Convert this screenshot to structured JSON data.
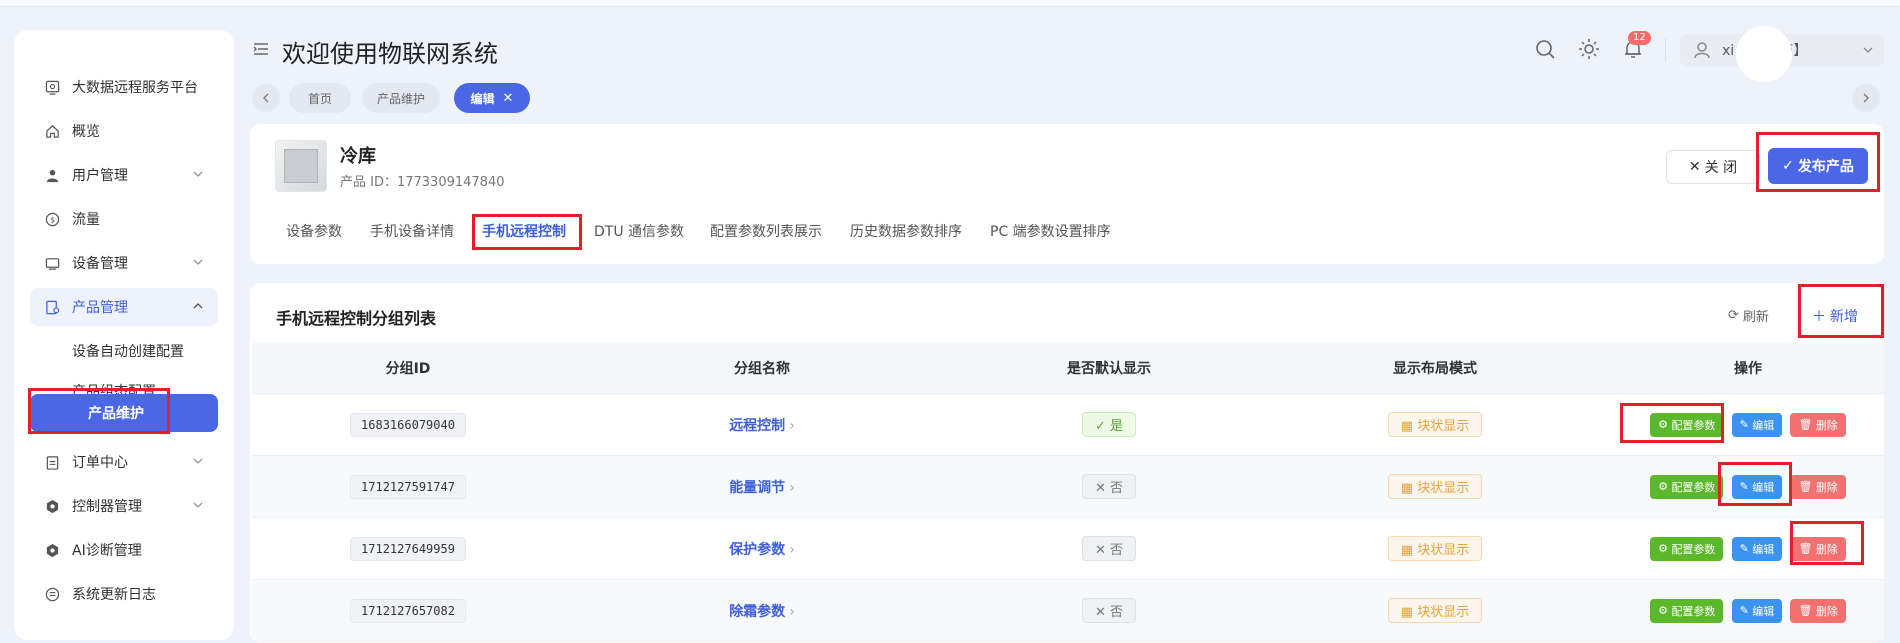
{
  "app": {
    "title": "欢迎使用物联网系统",
    "user_name": "xi st【厂商】",
    "notification_count": "12"
  },
  "sidebar": {
    "items": [
      {
        "label": "大数据远程服务平台",
        "icon": "monitor-icon"
      },
      {
        "label": "概览",
        "icon": "home-icon"
      },
      {
        "label": "用户管理",
        "icon": "user-icon"
      },
      {
        "label": "流量",
        "icon": "traffic-icon"
      },
      {
        "label": "设备管理",
        "icon": "device-icon"
      },
      {
        "label": "产品管理",
        "icon": "product-icon"
      },
      {
        "label": "订单中心",
        "icon": "order-icon"
      },
      {
        "label": "控制器管理",
        "icon": "controller-icon"
      },
      {
        "label": "AI诊断管理",
        "icon": "ai-icon"
      },
      {
        "label": "系统更新日志",
        "icon": "log-icon"
      }
    ],
    "submenu": [
      {
        "label": "设备自动创建配置"
      },
      {
        "label": "产品组态配置"
      },
      {
        "label": "产品维护"
      }
    ]
  },
  "tags": [
    {
      "label": "首页"
    },
    {
      "label": "产品维护"
    },
    {
      "label": "编辑"
    }
  ],
  "product": {
    "name": "冷库",
    "id_text": "产品 ID：1773309147840",
    "close_label": "关 闭",
    "publish_label": "发布产品",
    "tabs": [
      "设备参数",
      "手机设备详情",
      "手机远程控制",
      "DTU 通信参数",
      "配置参数列表展示",
      "历史数据参数排序",
      "PC 端参数设置排序"
    ]
  },
  "list": {
    "title": "手机远程控制分组列表",
    "refresh_label": "刷新",
    "add_label": "新增",
    "columns": [
      "分组ID",
      "分组名称",
      "是否默认显示",
      "显示布局模式",
      "操作"
    ],
    "rows": [
      {
        "id": "1683166079040",
        "name": "远程控制",
        "default": "是",
        "layout": "块状显示"
      },
      {
        "id": "1712127591747",
        "name": "能量调节",
        "default": "否",
        "layout": "块状显示"
      },
      {
        "id": "1712127649959",
        "name": "保护参数",
        "default": "否",
        "layout": "块状显示"
      },
      {
        "id": "1712127657082",
        "name": "除霜参数",
        "default": "否",
        "layout": "块状显示"
      }
    ],
    "actions": {
      "config": "配置参数",
      "edit": "编辑",
      "delete": "删除"
    }
  },
  "colors": {
    "primary": "#4a68e6",
    "success": "#5bb82a",
    "info": "#3b93ef",
    "danger": "#f27070",
    "highlight": "#e3202a"
  }
}
